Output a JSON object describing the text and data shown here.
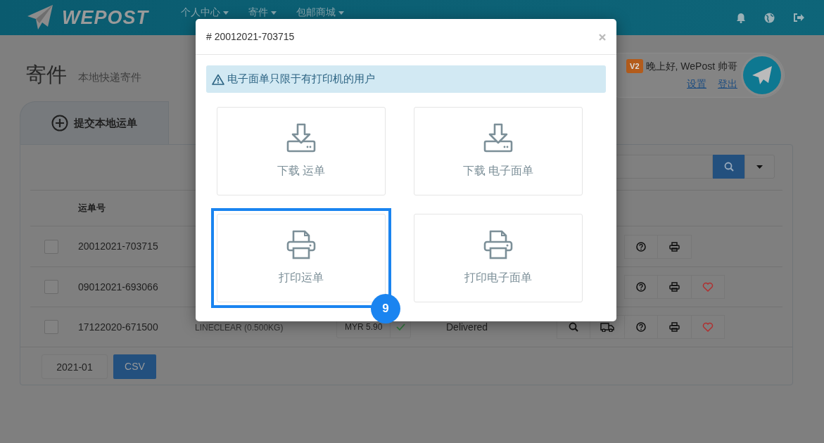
{
  "navbar": {
    "brand": "WEPOST",
    "menus": [
      {
        "label": "个人中心"
      },
      {
        "label": "寄件"
      },
      {
        "label": "包邮商城"
      }
    ]
  },
  "page": {
    "title": "寄件",
    "subtitle": "本地快递寄件"
  },
  "user": {
    "level": "V2",
    "greeting": "晚上好, WePost 帅哥",
    "links": [
      "设置",
      "登出"
    ]
  },
  "tabs": [
    {
      "label": "提交本地运单",
      "selected": false
    }
  ],
  "table": {
    "columns": [
      "运单号"
    ],
    "rows": [
      {
        "checked": false,
        "number": "20012021-703715",
        "actions": [
          {
            "kind": "help"
          },
          {
            "kind": "print"
          }
        ]
      },
      {
        "checked": false,
        "number": "09012021-693066",
        "actions": [
          {
            "kind": "help"
          },
          {
            "kind": "print"
          },
          {
            "kind": "like"
          }
        ]
      },
      {
        "checked": false,
        "number": "17122020-671500",
        "service": "LINECLEAR (0.500KG)",
        "price": "MYR 5.90",
        "paid": true,
        "status": "Delivered",
        "actions": [
          {
            "kind": "search"
          },
          {
            "kind": "truck"
          },
          {
            "kind": "help"
          },
          {
            "kind": "print"
          },
          {
            "kind": "like"
          }
        ]
      }
    ]
  },
  "footer": {
    "month": "2021-01",
    "export": "CSV"
  },
  "modal": {
    "title": "# 20012021-703715",
    "alert": "电子面单只限于有打印机的用户",
    "callout": "9",
    "options": [
      {
        "kind": "download",
        "label": "下载 运单",
        "highlighted": false
      },
      {
        "kind": "download",
        "label": "下载 电子面单",
        "highlighted": false
      },
      {
        "kind": "print",
        "label": "打印运单",
        "highlighted": true
      },
      {
        "kind": "print",
        "label": "打印电子面单",
        "highlighted": false
      }
    ]
  }
}
